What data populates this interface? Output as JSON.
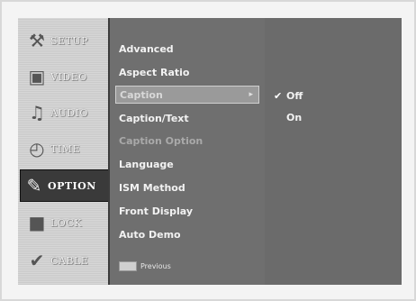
{
  "nav": [
    {
      "label": "SETUP",
      "icon": "wrench-icon",
      "glyph": "⚒"
    },
    {
      "label": "VIDEO",
      "icon": "tv-icon",
      "glyph": "▣"
    },
    {
      "label": "AUDIO",
      "icon": "speaker-icon",
      "glyph": "♫"
    },
    {
      "label": "TIME",
      "icon": "clock-icon",
      "glyph": "◴"
    },
    {
      "label": "OPTION",
      "icon": "option-icon",
      "glyph": "✎"
    },
    {
      "label": "LOCK",
      "icon": "lock-icon",
      "glyph": "■"
    },
    {
      "label": "CABLE",
      "icon": "cable-icon",
      "glyph": "✔"
    }
  ],
  "options": [
    {
      "label": "Advanced",
      "state": "normal"
    },
    {
      "label": "Aspect Ratio",
      "state": "normal"
    },
    {
      "label": "Caption",
      "state": "selected"
    },
    {
      "label": "Caption/Text",
      "state": "normal"
    },
    {
      "label": "Caption Option",
      "state": "disabled"
    },
    {
      "label": "Language",
      "state": "normal"
    },
    {
      "label": "ISM Method",
      "state": "normal"
    },
    {
      "label": "Front Display",
      "state": "normal"
    },
    {
      "label": "Auto Demo",
      "state": "normal"
    }
  ],
  "selected_arrow": "▸",
  "submenu": [
    {
      "label": "Off",
      "checked": true
    },
    {
      "label": "On",
      "checked": false
    }
  ],
  "check_glyph": "✔",
  "footer": {
    "previous_label": "Previous"
  }
}
